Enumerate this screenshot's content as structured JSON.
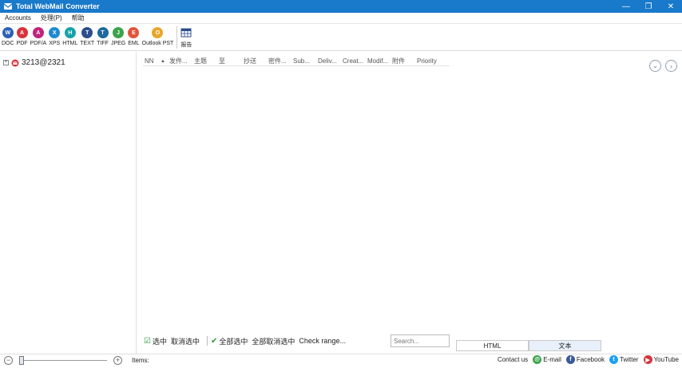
{
  "window": {
    "title": "Total WebMail Converter",
    "minimize": "—",
    "maximize": "❐",
    "close": "✕"
  },
  "menu": [
    "Accounts",
    "处理(P)",
    "帮助"
  ],
  "toolbar": {
    "tools": [
      {
        "label": "DOC",
        "glyph": "W",
        "color": "#2b61b6",
        "icon": "doc-icon"
      },
      {
        "label": "PDF",
        "glyph": "A",
        "color": "#d8333c",
        "icon": "pdf-icon"
      },
      {
        "label": "PDF/A",
        "glyph": "A",
        "color": "#c2237b",
        "icon": "pdfa-icon"
      },
      {
        "label": "XPS",
        "glyph": "X",
        "color": "#1f8ad1",
        "icon": "xps-icon"
      },
      {
        "label": "HTML",
        "glyph": "H",
        "color": "#17a3a8",
        "icon": "html-icon"
      },
      {
        "label": "TEXT",
        "glyph": "T",
        "color": "#2c4f8c",
        "icon": "text-icon"
      },
      {
        "label": "TIFF",
        "glyph": "T",
        "color": "#1d6b9c",
        "icon": "tiff-icon"
      },
      {
        "label": "JPEG",
        "glyph": "J",
        "color": "#3aa34c",
        "icon": "jpeg-icon"
      },
      {
        "label": "EML",
        "glyph": "E",
        "color": "#e2533a",
        "icon": "eml-icon"
      },
      {
        "label": "Outlook PST",
        "glyph": "O",
        "color": "#e8a62b",
        "icon": "outlook-pst-icon"
      }
    ],
    "report_label": "报告"
  },
  "tree": {
    "account": "3213@2321",
    "expand_glyph": "+"
  },
  "columns": [
    "NN",
    "▲",
    "发件...",
    "主题",
    "至",
    "抄送",
    "密件...",
    "Sub...",
    "Deliv...",
    "Creat...",
    "Modif...",
    "附件",
    "Priority"
  ],
  "nav": {
    "down": "⌄",
    "next": "›"
  },
  "bottom": {
    "select": "选中",
    "deselect": "取消选中",
    "select_all": "全部选中",
    "deselect_all": "全部取消选中",
    "check_range": "Check range...",
    "search_placeholder": "Search..."
  },
  "view_tabs": [
    "HTML",
    "文本"
  ],
  "status": {
    "zoom_minus": "−",
    "zoom_plus": "+",
    "items_label": "Items:",
    "contact": "Contact us",
    "email": "E-mail",
    "facebook": "Facebook",
    "twitter": "Twitter",
    "youtube": "YouTube"
  },
  "colors": {
    "titlebar": "#1979ca",
    "accent": "#2a9a3a"
  }
}
